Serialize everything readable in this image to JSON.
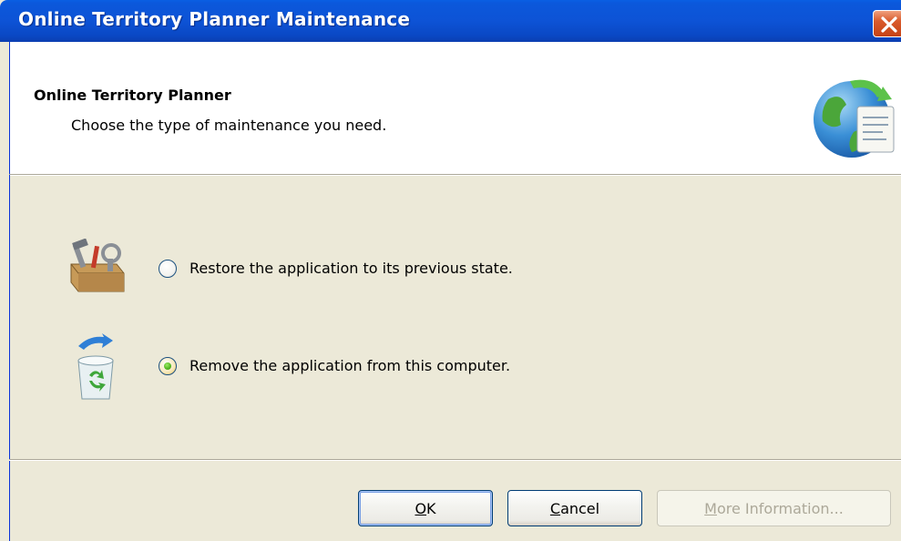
{
  "window": {
    "title": "Online Territory Planner Maintenance",
    "close_icon": "close-icon"
  },
  "header": {
    "title": "Online Territory Planner",
    "subtitle": "Choose the type of maintenance you need.",
    "icon": "globe-document-icon"
  },
  "options": [
    {
      "label": "Restore the application to its previous state.",
      "selected": false,
      "icon": "toolbox-icon"
    },
    {
      "label": "Remove the application from this computer.",
      "selected": true,
      "icon": "recycle-bin-icon"
    }
  ],
  "buttons": {
    "ok": {
      "accel": "O",
      "rest": "K"
    },
    "cancel": {
      "accel": "C",
      "rest": "ancel"
    },
    "more_info": {
      "accel": "M",
      "rest": "ore Information...",
      "enabled": false
    }
  },
  "colors": {
    "title_bar": "#0A52D6",
    "dialog_bg": "#ECE9D8",
    "close_button": "#D95A2C",
    "radio_selected": "#4FB51E"
  }
}
